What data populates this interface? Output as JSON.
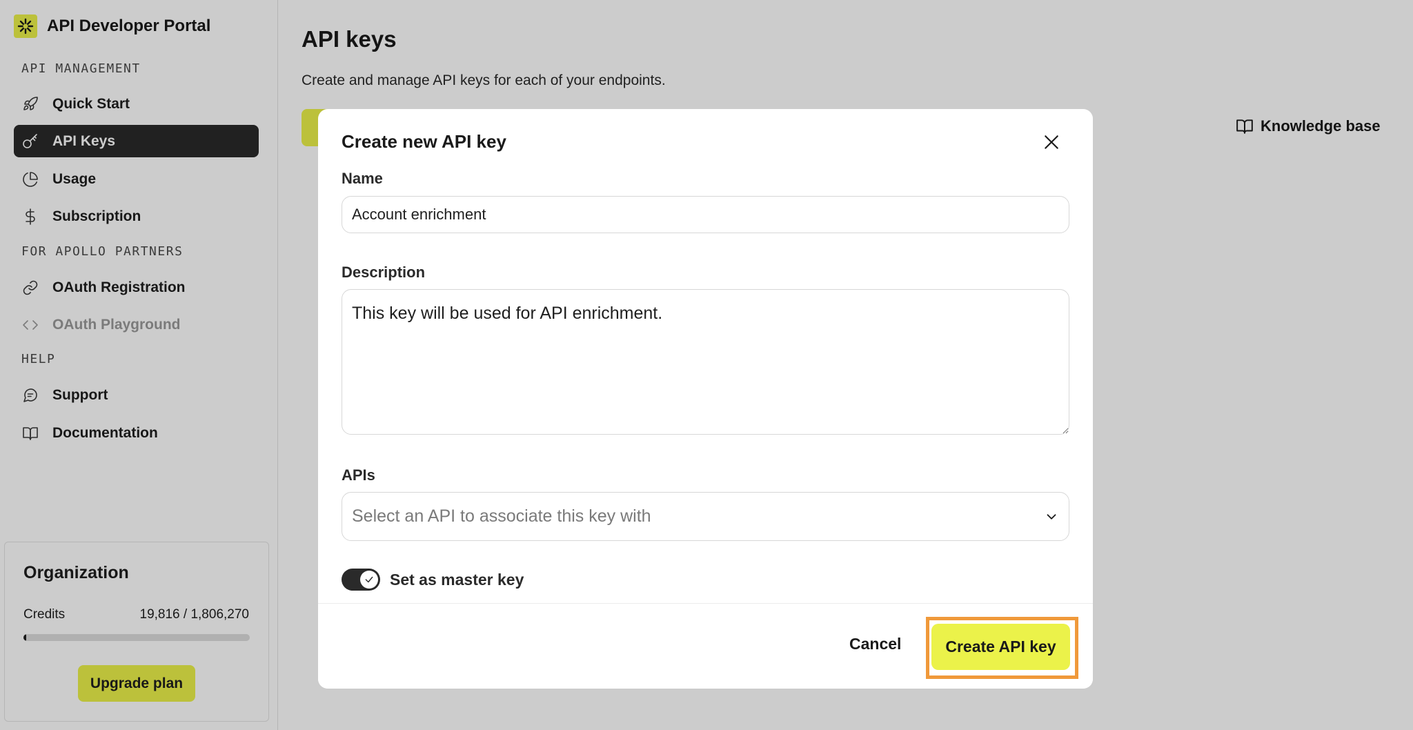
{
  "app": {
    "title": "API Developer Portal",
    "accent_color": "#ebf24a",
    "highlight_color": "#f0993a"
  },
  "sidebar": {
    "sections": [
      {
        "title": "API MANAGEMENT",
        "items": [
          {
            "label": "Quick Start",
            "icon": "rocket-icon",
            "active": false
          },
          {
            "label": "API Keys",
            "icon": "key-icon",
            "active": true
          },
          {
            "label": "Usage",
            "icon": "pie-chart-icon",
            "active": false
          },
          {
            "label": "Subscription",
            "icon": "dollar-icon",
            "active": false
          }
        ]
      },
      {
        "title": "FOR APOLLO PARTNERS",
        "items": [
          {
            "label": "OAuth Registration",
            "icon": "link-icon",
            "active": false
          },
          {
            "label": "OAuth Playground",
            "icon": "code-icon",
            "active": false,
            "disabled": true
          }
        ]
      },
      {
        "title": "HELP",
        "items": [
          {
            "label": "Support",
            "icon": "chat-icon",
            "active": false
          },
          {
            "label": "Documentation",
            "icon": "book-icon",
            "active": false
          }
        ]
      }
    ],
    "org": {
      "title": "Organization",
      "credits_label": "Credits",
      "credits_value": "19,816 / 1,806,270",
      "credits_used_fraction": 0.011,
      "upgrade_label": "Upgrade plan"
    }
  },
  "main": {
    "title": "API keys",
    "subtitle": "Create and manage API keys for each of your endpoints.",
    "knowledge_base": "Knowledge base"
  },
  "modal": {
    "title": "Create new API key",
    "name_label": "Name",
    "name_value": "Account enrichment",
    "description_label": "Description",
    "description_value": "This key will be used for API enrichment.",
    "apis_label": "APIs",
    "apis_placeholder": "Select an API to associate this key with",
    "master_key_label": "Set as master key",
    "master_key_on": true,
    "cancel_label": "Cancel",
    "create_label": "Create API key"
  }
}
